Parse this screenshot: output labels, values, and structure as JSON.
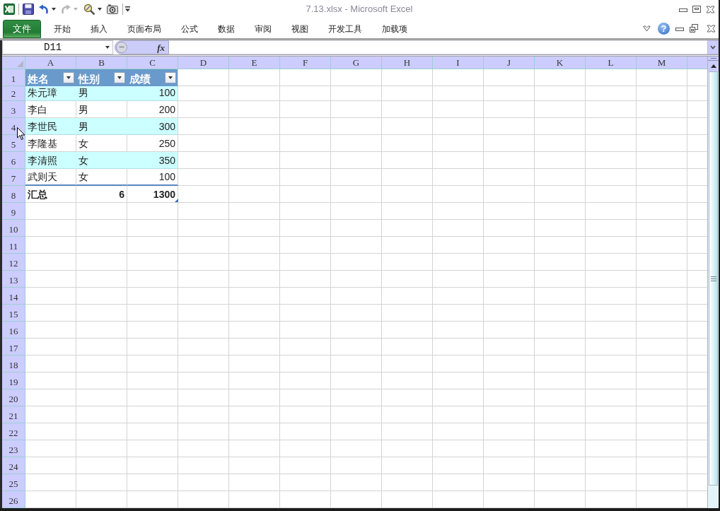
{
  "window": {
    "title": "7.13.xlsx - Microsoft Excel"
  },
  "quick_access_toolbar": [
    {
      "kind": "save",
      "disabled": false
    },
    {
      "kind": "undo",
      "disabled": false
    },
    {
      "kind": "redo",
      "disabled": true
    },
    {
      "kind": "tools",
      "disabled": false
    },
    {
      "kind": "camera",
      "disabled": false
    },
    {
      "kind": "customize",
      "disabled": false
    }
  ],
  "ribbon_tabs": [
    {
      "label": "文件",
      "kind": "file",
      "selected": false
    },
    {
      "label": "开始",
      "kind": "tab",
      "selected": false
    },
    {
      "label": "插入",
      "kind": "tab",
      "selected": false
    },
    {
      "label": "页面布局",
      "kind": "tab",
      "selected": false
    },
    {
      "label": "公式",
      "kind": "tab",
      "selected": false
    },
    {
      "label": "数据",
      "kind": "tab",
      "selected": false
    },
    {
      "label": "审阅",
      "kind": "tab",
      "selected": false
    },
    {
      "label": "视图",
      "kind": "tab",
      "selected": false
    },
    {
      "label": "开发工具",
      "kind": "tab",
      "selected": false
    },
    {
      "label": "加载项",
      "kind": "tab",
      "selected": false
    }
  ],
  "help_button": "?",
  "formula_bar": {
    "name_box": "D11",
    "function_button": "fx"
  },
  "column_headers": [
    "A",
    "B",
    "C",
    "D",
    "E",
    "F",
    "G",
    "H",
    "I",
    "J",
    "K",
    "L",
    "M"
  ],
  "row_headers": [
    "1",
    "2",
    "3",
    "4",
    "5",
    "6",
    "7",
    "8",
    "9",
    "10",
    "11",
    "12",
    "13",
    "14",
    "15",
    "16",
    "17",
    "18",
    "19",
    "20",
    "21",
    "22",
    "23",
    "24",
    "25",
    "26"
  ],
  "table": {
    "columns": [
      "姓名",
      "性别",
      "成绩"
    ],
    "rows": [
      {
        "banded": true,
        "cells": [
          "朱元璋",
          "男",
          "100"
        ]
      },
      {
        "banded": false,
        "cells": [
          "李白",
          "男",
          "200"
        ]
      },
      {
        "banded": true,
        "cells": [
          "李世民",
          "男",
          "300"
        ]
      },
      {
        "banded": false,
        "cells": [
          "李隆基",
          "女",
          "250"
        ]
      },
      {
        "banded": true,
        "cells": [
          "李清照",
          "女",
          "350"
        ]
      },
      {
        "banded": false,
        "cells": [
          "武则天",
          "女",
          "100"
        ]
      }
    ],
    "total_row": [
      "汇总",
      "6",
      "1300"
    ]
  }
}
